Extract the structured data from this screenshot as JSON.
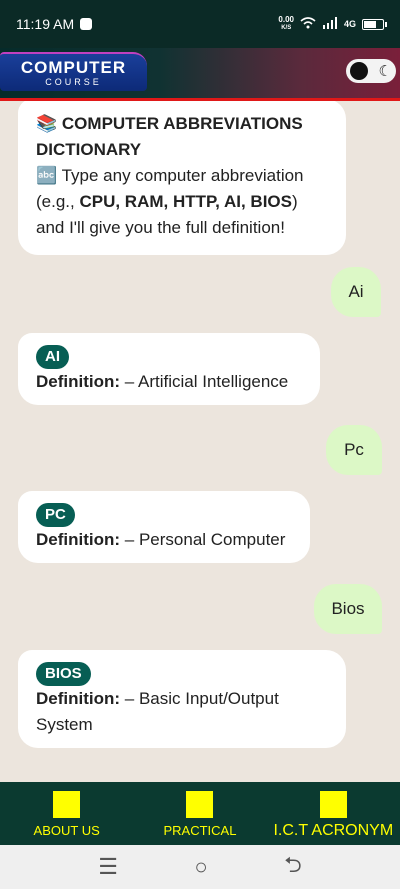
{
  "status": {
    "time": "11:19 AM",
    "speed_value": "0.00",
    "speed_unit": "K/S",
    "net": "4G"
  },
  "header": {
    "logo_title": "COMPUTER",
    "logo_sub": "COURSE"
  },
  "chat": {
    "intro": {
      "emoji": "📚",
      "title": "COMPUTER ABBREVIATIONS DICTIONARY",
      "abc": "🔤",
      "line_pre": "Type any computer abbreviation (e.g., ",
      "examples": "CPU, RAM, HTTP, AI, BIOS",
      "line_post": ") and I'll give you the full definition!"
    },
    "messages": [
      {
        "user": "Ai",
        "badge": "AI",
        "def_label": "Definition:",
        "def_text": "– Artificial Intelligence"
      },
      {
        "user": "Pc",
        "badge": "PC",
        "def_label": "Definition:",
        "def_text": "– Personal Computer"
      },
      {
        "user": "Bios",
        "badge": "BIOS",
        "def_label": "Definition:",
        "def_text": "– Basic Input/Output System"
      }
    ]
  },
  "nav": [
    {
      "label": "ABOUT US"
    },
    {
      "label": "PRACTICAL"
    },
    {
      "label": "I.C.T ACRONYM"
    }
  ],
  "colors": {
    "accent": "#075e54",
    "nav_text": "#ffff00",
    "user_bubble": "#dcf8c6",
    "chat_bg": "#ece5dd"
  }
}
